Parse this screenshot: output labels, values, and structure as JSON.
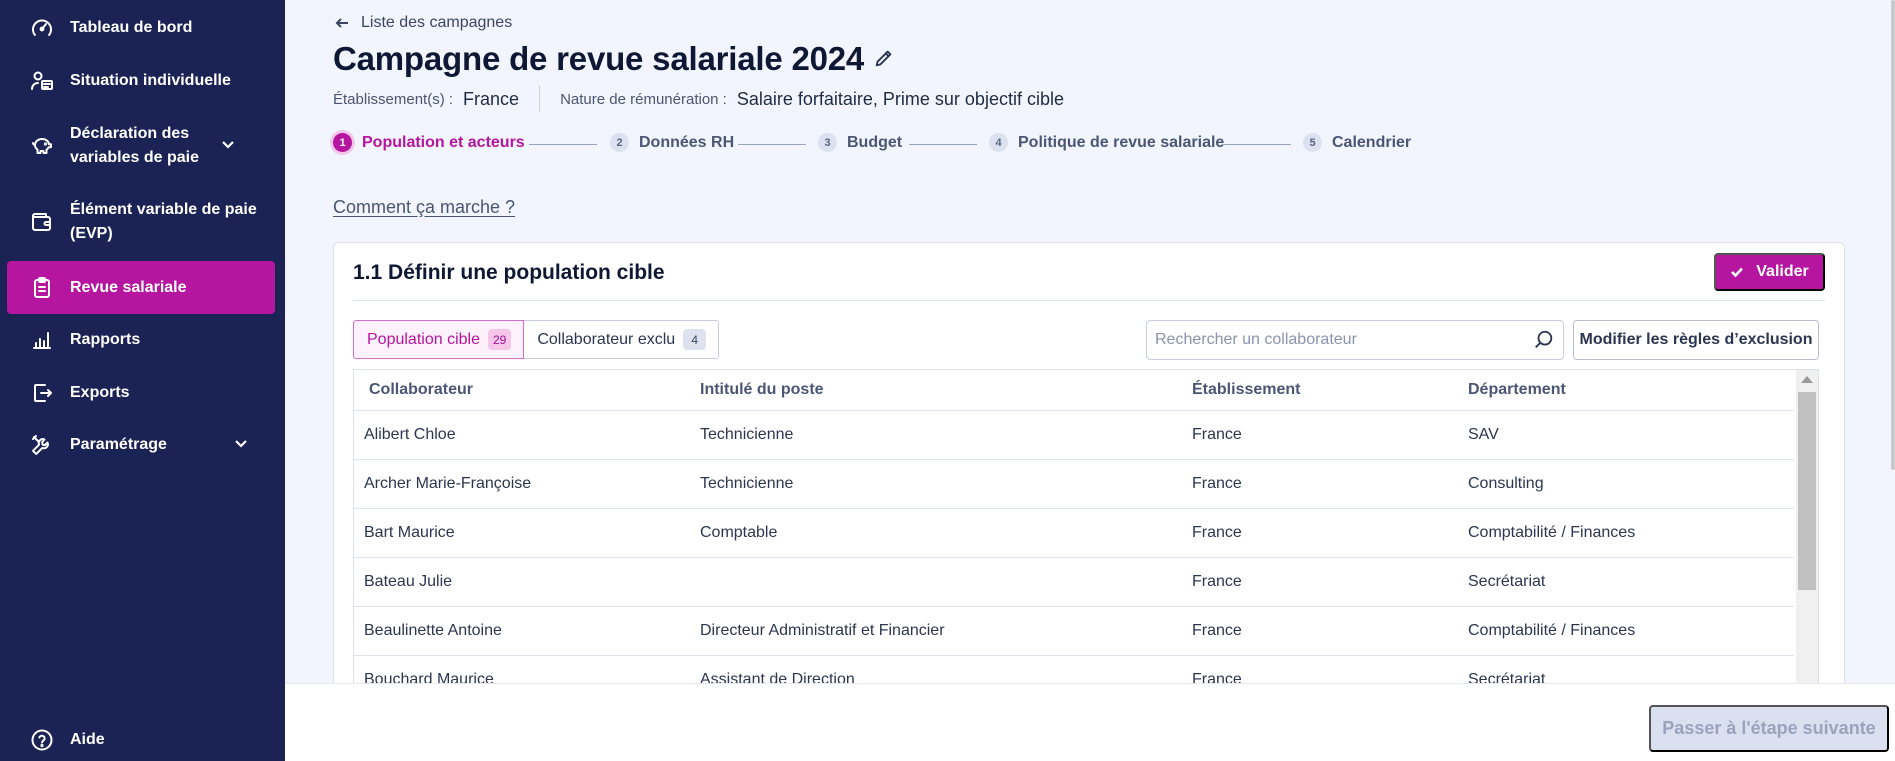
{
  "sidebar": {
    "items": [
      {
        "label": "Tableau de bord",
        "icon": "dashboard-gauge-icon"
      },
      {
        "label": "Situation individuelle",
        "icon": "person-card-icon"
      },
      {
        "label": "Déclaration des variables de paie",
        "icon": "piggy-bank-icon"
      },
      {
        "label": "Élément variable de paie (EVP)",
        "icon": "wallet-icon"
      },
      {
        "label": "Revue salariale",
        "icon": "clipboard-icon"
      },
      {
        "label": "Rapports",
        "icon": "bar-chart-icon"
      },
      {
        "label": "Exports",
        "icon": "export-icon"
      },
      {
        "label": "Paramétrage",
        "icon": "tools-icon"
      }
    ],
    "help_label": "Aide"
  },
  "header": {
    "back_label": "Liste des campagnes",
    "title": "Campagne de revue salariale 2024",
    "etab_key": "Établissement(s) :",
    "etab_value": "France",
    "nature_key": "Nature de rémunération :",
    "nature_value": "Salaire forfaitaire, Prime sur objectif cible"
  },
  "stepper": {
    "steps": [
      {
        "num": "1",
        "label": "Population et acteurs"
      },
      {
        "num": "2",
        "label": "Données RH"
      },
      {
        "num": "3",
        "label": "Budget"
      },
      {
        "num": "4",
        "label": "Politique de revue salariale"
      },
      {
        "num": "5",
        "label": "Calendrier"
      }
    ]
  },
  "howto_label": "Comment ça marche ?",
  "card": {
    "title": "1.1 Définir une population cible",
    "validate_label": "Valider",
    "tabs": [
      {
        "label": "Population cible",
        "count": "29"
      },
      {
        "label": "Collaborateur exclu",
        "count": "4"
      }
    ],
    "search_placeholder": "Rechercher un collaborateur",
    "modify_label": "Modifier les règles d’exclusion",
    "columns": [
      "Collaborateur",
      "Intitulé du poste",
      "Établissement",
      "Département"
    ],
    "rows": [
      [
        "Alibert Chloe",
        "Technicienne",
        "France",
        "SAV"
      ],
      [
        "Archer Marie-Françoise",
        "Technicienne",
        "France",
        "Consulting"
      ],
      [
        "Bart Maurice",
        "Comptable",
        "France",
        "Comptabilité / Finances"
      ],
      [
        "Bateau Julie",
        "",
        "France",
        "Secrétariat"
      ],
      [
        "Beaulinette Antoine",
        "Directeur Administratif et Financier",
        "France",
        "Comptabilité / Finances"
      ],
      [
        "Bouchard Maurice",
        "Assistant de Direction",
        "France",
        "Secrétariat"
      ]
    ]
  },
  "footer": {
    "next_label": "Passer à l'étape suivante"
  },
  "colors": {
    "sidebar_bg": "#1b2254",
    "accent": "#b5159f",
    "page_bg": "#f2f5fd"
  }
}
